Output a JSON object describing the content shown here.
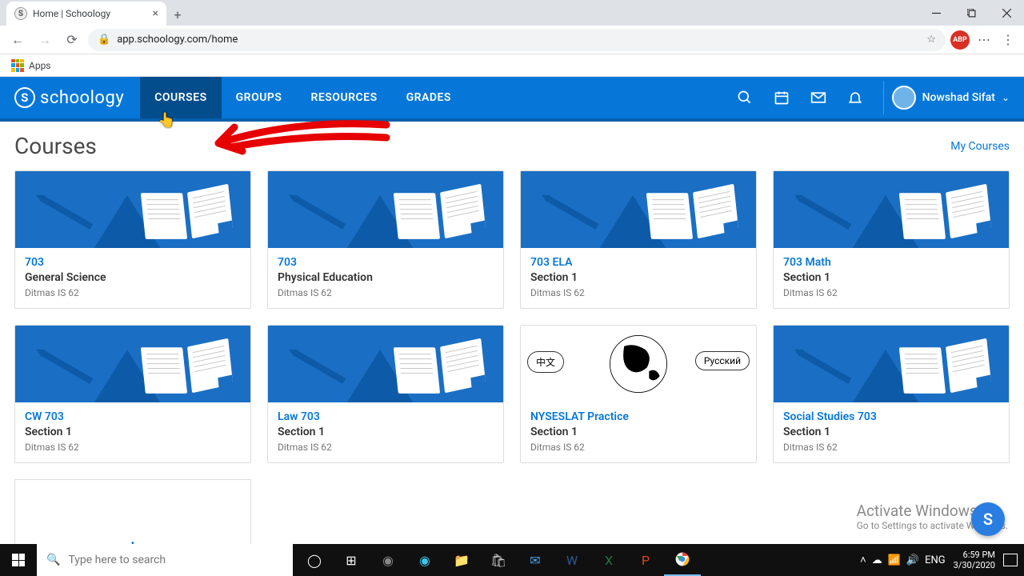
{
  "browser": {
    "tab_title": "Home | Schoology",
    "url": "app.schoology.com/home",
    "bookmarks": {
      "apps": "Apps"
    }
  },
  "header": {
    "brand": "schoology",
    "nav": {
      "courses": "COURSES",
      "groups": "GROUPS",
      "resources": "RESOURCES",
      "grades": "GRADES"
    },
    "user": "Nowshad Sifat"
  },
  "page": {
    "title": "Courses",
    "my_courses": "My Courses"
  },
  "courses": [
    {
      "code": "703",
      "name": "General Science",
      "school": "Ditmas IS 62",
      "style": "book"
    },
    {
      "code": "703",
      "name": "Physical Education",
      "school": "Ditmas IS 62",
      "style": "book"
    },
    {
      "code": "703 ELA",
      "name": "Section 1",
      "school": "Ditmas IS 62",
      "style": "book"
    },
    {
      "code": "703 Math",
      "name": "Section 1",
      "school": "Ditmas IS 62",
      "style": "book"
    },
    {
      "code": "CW 703",
      "name": "Section 1",
      "school": "Ditmas IS 62",
      "style": "book"
    },
    {
      "code": "Law 703",
      "name": "Section 1",
      "school": "Ditmas IS 62",
      "style": "book"
    },
    {
      "code": "NYSESLAT Practice",
      "name": "Section 1",
      "school": "Ditmas IS 62",
      "style": "globe"
    },
    {
      "code": "Social Studies 703",
      "name": "Section 1",
      "school": "Ditmas IS 62",
      "style": "book"
    }
  ],
  "globe_labels": {
    "left": "中文",
    "right": "Русский"
  },
  "watermark": {
    "line1": "Activate Windows",
    "line2": "Go to Settings to activate Windows."
  },
  "taskbar": {
    "search_placeholder": "Type here to search",
    "time": "6:59 PM",
    "date": "3/30/2020"
  }
}
